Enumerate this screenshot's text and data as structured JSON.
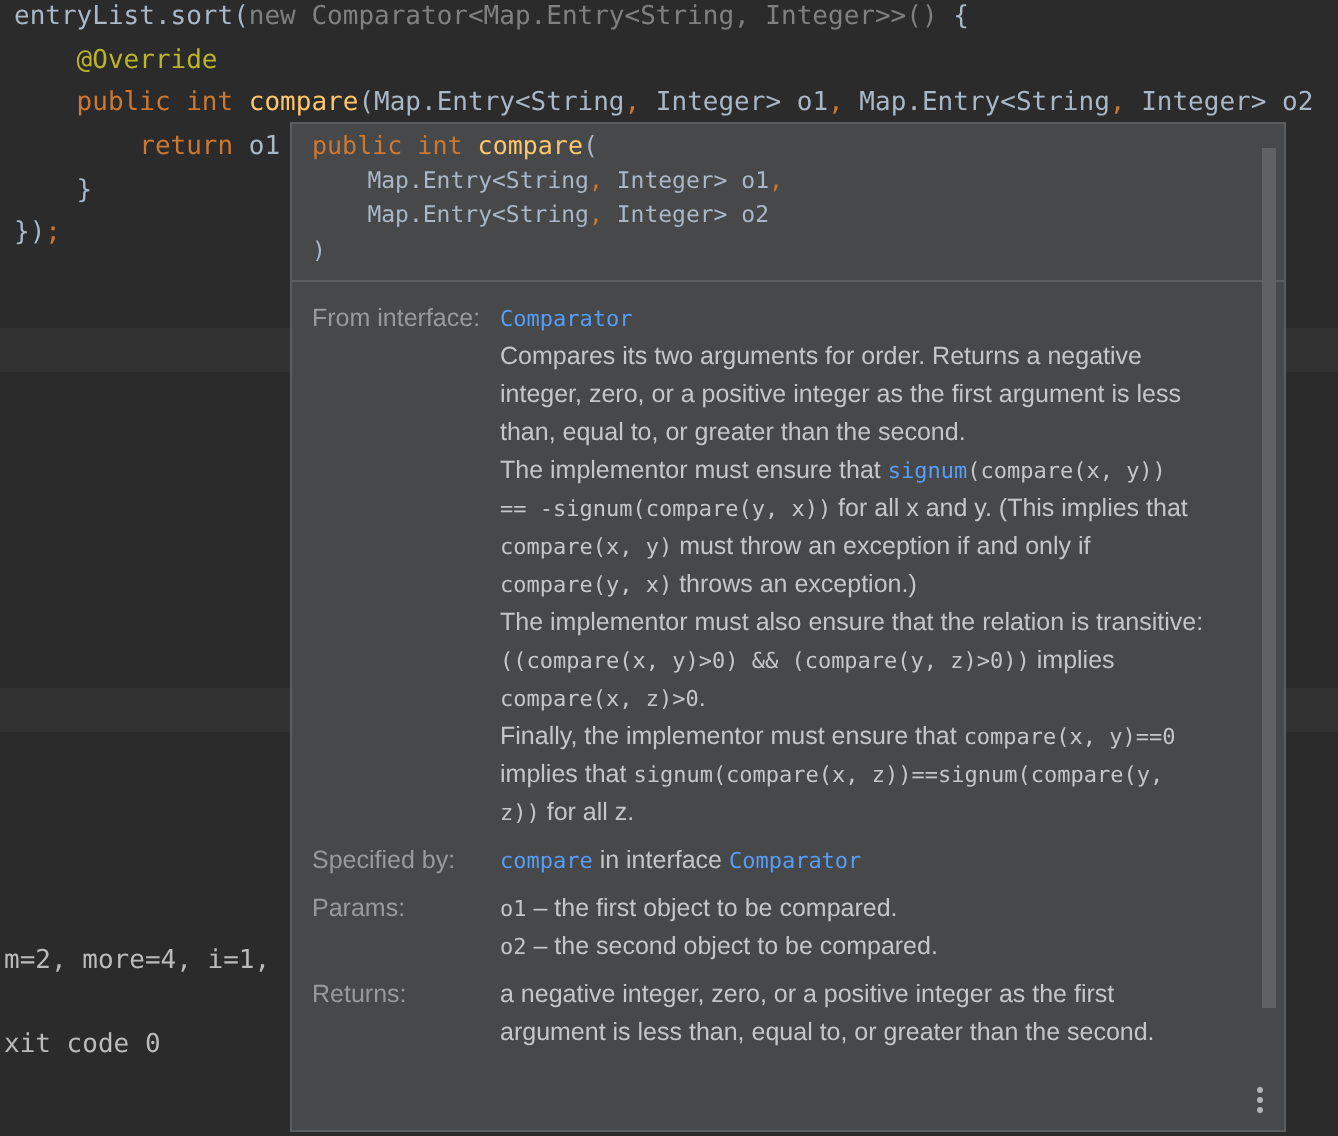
{
  "editor": {
    "code_lines": [
      [
        {
          "t": "entryList.sort(",
          "kind": "plain"
        },
        {
          "t": "new Comparator<Map.Entry<String, Integer>>()",
          "kind": "dim"
        },
        {
          "t": " {",
          "kind": "plain"
        }
      ],
      [
        {
          "t": "    @Override",
          "kind": "annotation"
        }
      ],
      [
        {
          "t": "    public int ",
          "kind": "keyword"
        },
        {
          "t": "compare",
          "kind": "method"
        },
        {
          "t": "(Map.Entry<String",
          "kind": "plain"
        },
        {
          "t": ", ",
          "kind": "keyword"
        },
        {
          "t": "Integer> o1",
          "kind": "plain"
        },
        {
          "t": ", ",
          "kind": "keyword"
        },
        {
          "t": "Map.Entry<String",
          "kind": "plain"
        },
        {
          "t": ", ",
          "kind": "keyword"
        },
        {
          "t": "Integer> o2",
          "kind": "plain"
        }
      ],
      [
        {
          "t": "        return",
          "kind": "keyword"
        },
        {
          "t": " o1",
          "kind": "plain"
        }
      ],
      [
        {
          "t": "    }",
          "kind": "plain"
        }
      ],
      [
        {
          "t": "})",
          "kind": "plain"
        },
        {
          "t": ";",
          "kind": "keyword"
        }
      ]
    ]
  },
  "console": {
    "lines": [
      "m=2, more=4, i=1,",
      "xit code 0"
    ]
  },
  "popup": {
    "signature": [
      [
        {
          "t": "public int ",
          "kind": "keyword"
        },
        {
          "t": "compare",
          "kind": "method"
        },
        {
          "t": "(",
          "kind": "plain"
        }
      ],
      [
        {
          "t": "    Map.Entry<String",
          "kind": "plain"
        },
        {
          "t": ", ",
          "kind": "keyword"
        },
        {
          "t": "Integer> o1",
          "kind": "plain"
        },
        {
          "t": ",",
          "kind": "keyword"
        }
      ],
      [
        {
          "t": "    Map.Entry<String",
          "kind": "plain"
        },
        {
          "t": ", ",
          "kind": "keyword"
        },
        {
          "t": "Integer> o2",
          "kind": "plain"
        }
      ],
      [
        {
          "t": ")",
          "kind": "plain"
        }
      ]
    ],
    "sections": [
      {
        "label": "From interface:",
        "paragraphs": [
          [
            {
              "t": "Comparator",
              "kind": "link"
            }
          ],
          [
            {
              "t": "Compares its two arguments for order. Returns a negative integer, zero, or a positive integer as the first argument is less than, equal to, or greater than the second.",
              "kind": "text"
            }
          ],
          [
            {
              "t": "The implementor must ensure that ",
              "kind": "text"
            },
            {
              "t": "signum",
              "kind": "link"
            },
            {
              "t": "(compare(x, y)) == -signum(compare(y, x))",
              "kind": "code"
            },
            {
              "t": " for all x and y. (This implies that ",
              "kind": "text"
            },
            {
              "t": "compare(x, y)",
              "kind": "code"
            },
            {
              "t": " must throw an exception if and only if ",
              "kind": "text"
            },
            {
              "t": "compare(y, x)",
              "kind": "code"
            },
            {
              "t": " throws an exception.)",
              "kind": "text"
            }
          ],
          [
            {
              "t": "The implementor must also ensure that the relation is transitive: ",
              "kind": "text"
            },
            {
              "t": "((compare(x, y)>0) && (compare(y, z)>0))",
              "kind": "code"
            },
            {
              "t": " implies ",
              "kind": "text"
            },
            {
              "t": "compare(x, z)>0",
              "kind": "code"
            },
            {
              "t": ".",
              "kind": "text"
            }
          ],
          [
            {
              "t": "Finally, the implementor must ensure that ",
              "kind": "text"
            },
            {
              "t": "compare(x, y)==0",
              "kind": "code"
            },
            {
              "t": " implies that ",
              "kind": "text"
            },
            {
              "t": "signum(compare(x, z))==signum(compare(y, z))",
              "kind": "code"
            },
            {
              "t": " for all z.",
              "kind": "text"
            }
          ]
        ]
      },
      {
        "label": "Specified by:",
        "paragraphs": [
          [
            {
              "t": "compare",
              "kind": "link"
            },
            {
              "t": " in interface ",
              "kind": "text"
            },
            {
              "t": "Comparator",
              "kind": "link"
            }
          ]
        ]
      },
      {
        "label": "Params:",
        "paragraphs": [
          [
            {
              "t": "o1",
              "kind": "code"
            },
            {
              "t": " – the first object to be compared.",
              "kind": "text"
            }
          ],
          [
            {
              "t": "o2",
              "kind": "code"
            },
            {
              "t": " – the second object to be compared.",
              "kind": "text"
            }
          ]
        ]
      },
      {
        "label": "Returns:",
        "paragraphs": [
          [
            {
              "t": "a negative integer, zero, or a positive integer as the first argument is less than, equal to, or greater than the second.",
              "kind": "text"
            }
          ]
        ]
      }
    ]
  }
}
